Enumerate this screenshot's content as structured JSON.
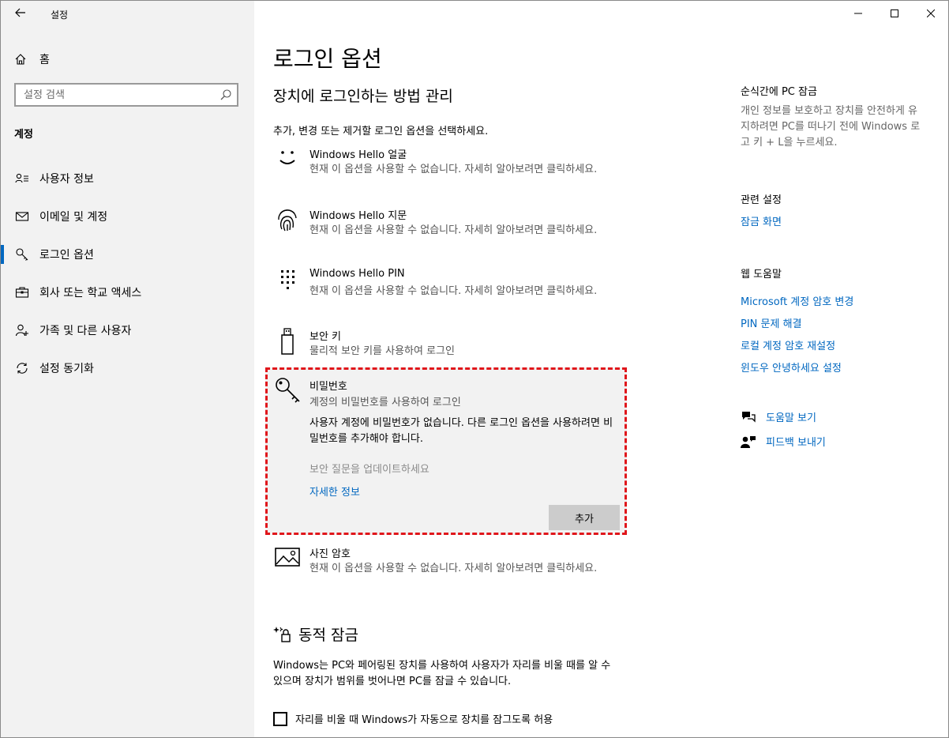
{
  "app": {
    "title": "설정",
    "window_controls": [
      "minimize",
      "maximize",
      "close"
    ]
  },
  "sidebar": {
    "home_label": "홈",
    "search_placeholder": "설정 검색",
    "section_title": "계정",
    "items": [
      {
        "label": "사용자 정보",
        "icon": "user-info-icon"
      },
      {
        "label": "이메일 및 계정",
        "icon": "mail-icon"
      },
      {
        "label": "로그인 옵션",
        "icon": "key-icon",
        "active": true
      },
      {
        "label": "회사 또는 학교 액세스",
        "icon": "briefcase-icon"
      },
      {
        "label": "가족 및 다른 사용자",
        "icon": "add-user-icon"
      },
      {
        "label": "설정 동기화",
        "icon": "sync-icon"
      }
    ]
  },
  "main": {
    "page_title": "로그인 옵션",
    "subtitle": "장치에 로그인하는 방법 관리",
    "description": "추가, 변경 또는 제거할 로그인 옵션을 선택하세요.",
    "options": [
      {
        "title": "Windows Hello 얼굴",
        "subtitle": "현재 이 옵션을 사용할 수 없습니다. 자세히 알아보려면 클릭하세요.",
        "icon": "face-icon"
      },
      {
        "title": "Windows Hello 지문",
        "subtitle": "현재 이 옵션을 사용할 수 없습니다. 자세히 알아보려면 클릭하세요.",
        "icon": "fingerprint-icon"
      },
      {
        "title": "Windows Hello PIN",
        "subtitle": "현재 이 옵션을 사용할 수 없습니다. 자세히 알아보려면 클릭하세요.",
        "icon": "pin-keypad-icon"
      },
      {
        "title": "보안 키",
        "subtitle": "물리적 보안 키를 사용하여 로그인",
        "icon": "usb-key-icon"
      }
    ],
    "password": {
      "title": "비밀번호",
      "subtitle": "계정의 비밀번호를 사용하여 로그인",
      "message": "사용자 계정에 비밀번호가 없습니다. 다른 로그인 옵션을 사용하려면 비밀번호를 추가해야 합니다.",
      "security_questions": "보안 질문을 업데이트하세요",
      "learn_more": "자세한 정보",
      "add_button": "추가",
      "icon": "password-key-icon"
    },
    "picture_password": {
      "title": "사진 암호",
      "subtitle": "현재 이 옵션을 사용할 수 없습니다. 자세히 알아보려면 클릭하세요.",
      "icon": "picture-icon"
    },
    "dynamic_lock": {
      "title": "동적 잠금",
      "description": "Windows는 PC와 페어링된 장치를 사용하여 사용자가 자리를 비울 때를 알 수 있으며 장치가 범위를 벗어나면 PC를 잠글 수 있습니다.",
      "checkbox_label": "자리를 비울 때 Windows가 자동으로 장치를 잠그도록 허용",
      "checked": false
    }
  },
  "right": {
    "lock_title": "순식간에 PC 잠금",
    "lock_text": "개인 정보를 보호하고 장치를 안전하게 유지하려면 PC를 떠나기 전에 Windows 로고 키 + L을 누르세요.",
    "related_title": "관련 설정",
    "related_link": "잠금 화면",
    "web_help_title": "웹 도움말",
    "web_links": [
      "Microsoft 계정 암호 변경",
      "PIN 문제 해결",
      "로컬 계정 암호 재설정",
      "윈도우 안녕하세요 설정"
    ],
    "help_link": "도움말 보기",
    "feedback_link": "피드백 보내기"
  },
  "colors": {
    "accent": "#0067c0",
    "sidebar_bg": "#f2f2f2",
    "highlight_border": "#e0161b"
  }
}
